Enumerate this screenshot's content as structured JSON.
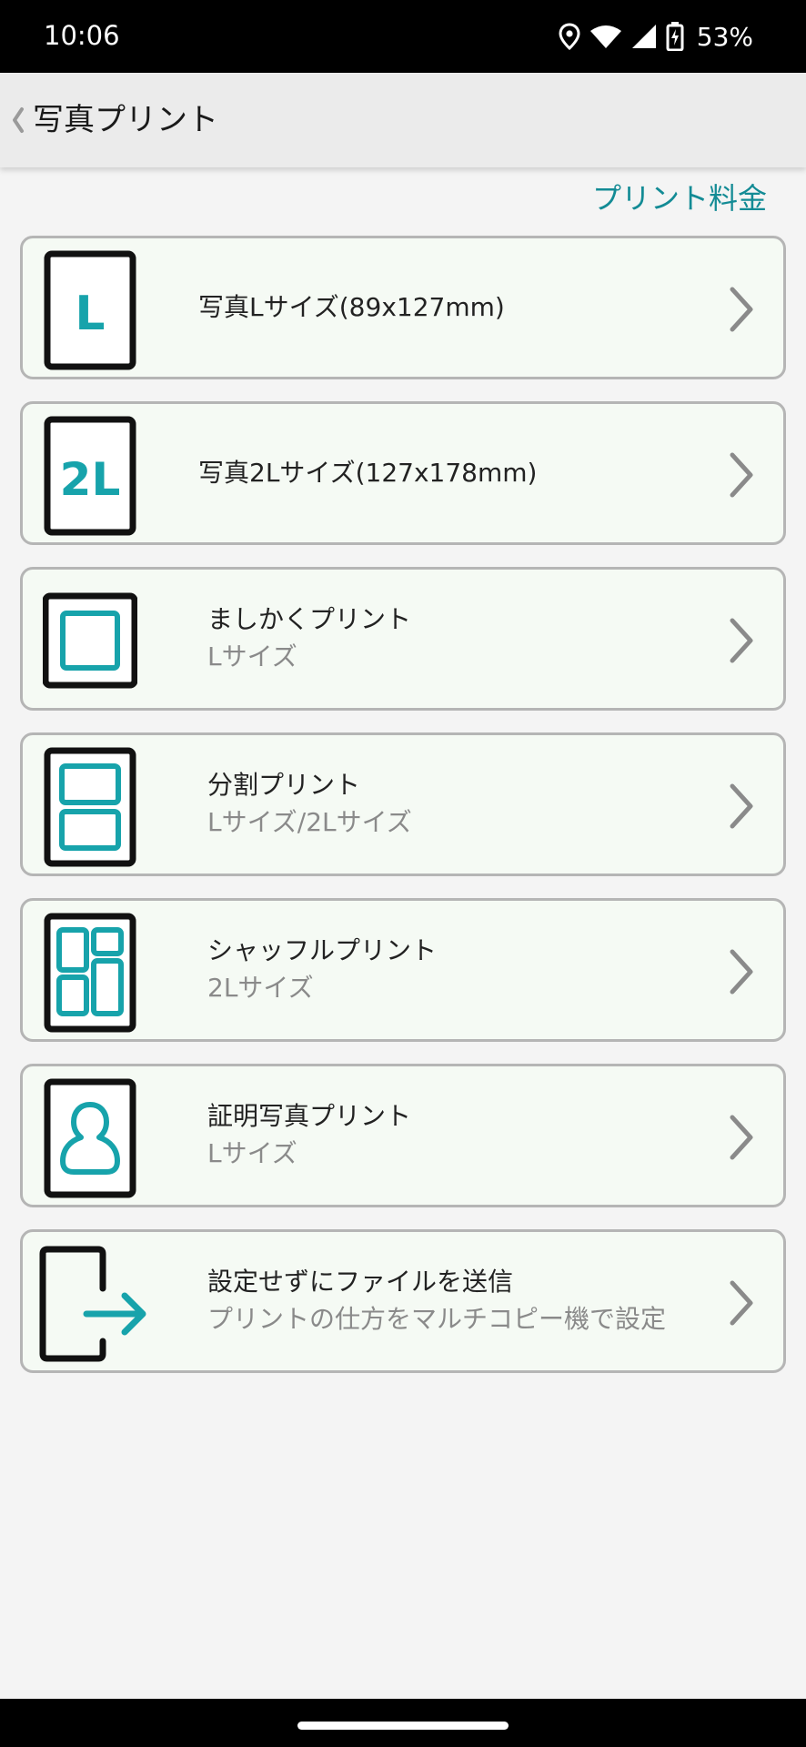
{
  "status_bar": {
    "time": "10:06",
    "battery_percent": "53%",
    "icons": [
      "location-icon",
      "wifi-icon",
      "signal-icon",
      "battery-charging-icon"
    ]
  },
  "header": {
    "title": "写真プリント",
    "back_icon": "chevron-left-icon"
  },
  "price_link": "プリント料金",
  "colors": {
    "accent": "#17a3ab",
    "link": "#138b95",
    "card_bg": "#f5faf4",
    "card_border": "#b5b5b5"
  },
  "menu": {
    "items": [
      {
        "icon": "l-size-icon",
        "icon_text": "L",
        "title": "写真Lサイズ(89x127mm)",
        "subtitle": ""
      },
      {
        "icon": "2l-size-icon",
        "icon_text": "2L",
        "title": "写真2Lサイズ(127x178mm)",
        "subtitle": ""
      },
      {
        "icon": "square-print-icon",
        "title": "ましかくプリント",
        "subtitle": "Lサイズ"
      },
      {
        "icon": "split-print-icon",
        "title": "分割プリント",
        "subtitle": "Lサイズ/2Lサイズ"
      },
      {
        "icon": "shuffle-print-icon",
        "title": "シャッフルプリント",
        "subtitle": "2Lサイズ"
      },
      {
        "icon": "id-photo-icon",
        "title": "証明写真プリント",
        "subtitle": "Lサイズ"
      },
      {
        "icon": "send-file-icon",
        "title": "設定せずにファイルを送信",
        "subtitle": "プリントの仕方をマルチコピー機で設定"
      }
    ]
  }
}
